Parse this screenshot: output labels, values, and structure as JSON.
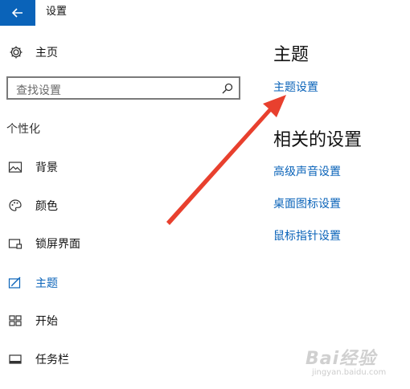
{
  "window": {
    "title": "设置"
  },
  "sidebar": {
    "home_label": "主页",
    "search_placeholder": "查找设置",
    "section_label": "个性化",
    "items": [
      {
        "label": "背景",
        "icon": "image-icon",
        "active": false
      },
      {
        "label": "颜色",
        "icon": "palette-icon",
        "active": false
      },
      {
        "label": "锁屏界面",
        "icon": "lock-screen-icon",
        "active": false
      },
      {
        "label": "主题",
        "icon": "theme-brush-icon",
        "active": true
      },
      {
        "label": "开始",
        "icon": "start-tiles-icon",
        "active": false
      },
      {
        "label": "任务栏",
        "icon": "taskbar-icon",
        "active": false
      }
    ]
  },
  "main": {
    "theme_heading": "主题",
    "theme_settings_link": "主题设置",
    "related_heading": "相关的设置",
    "related_links": [
      "高级声音设置",
      "桌面图标设置",
      "鼠标指针设置"
    ]
  },
  "watermark": {
    "brand": "Bai经验",
    "sub": "jingyan.baidu.com"
  },
  "colors": {
    "accent": "#0a63b9",
    "arrow": "#e8402e",
    "title_bar_back": "#0a63b9"
  }
}
